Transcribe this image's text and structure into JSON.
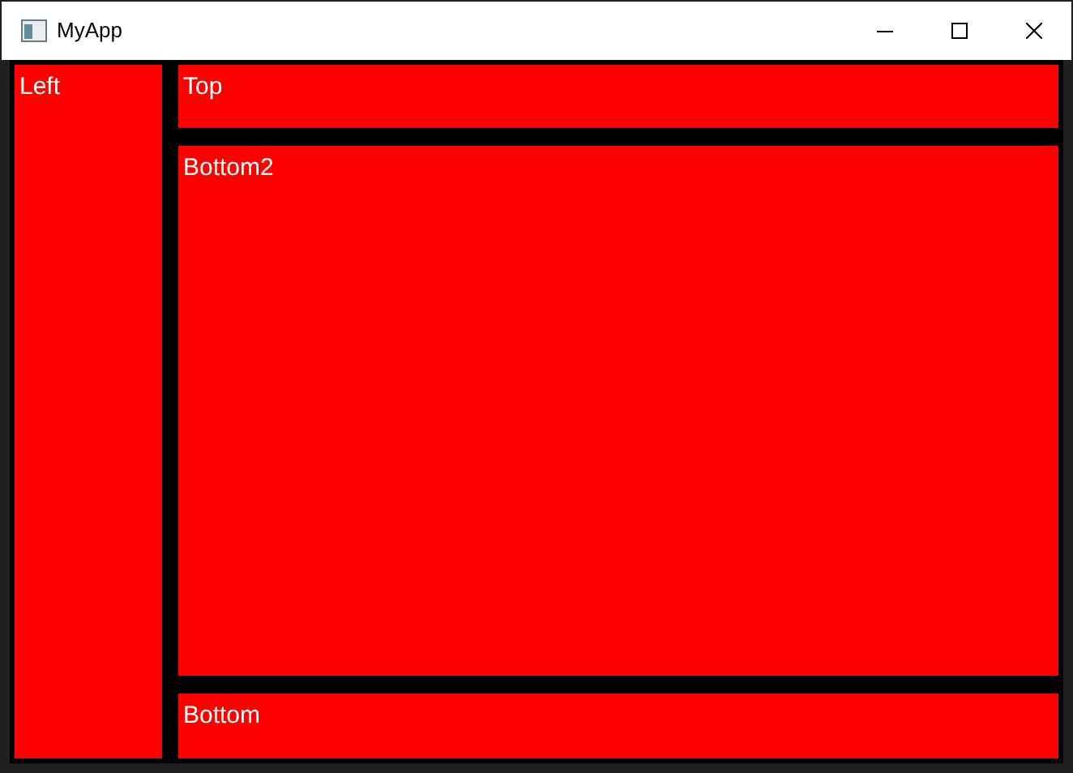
{
  "window": {
    "title": "MyApp"
  },
  "left_panel": {
    "label": "Left"
  },
  "right_panels": [
    {
      "label": "Top"
    },
    {
      "label": "Bottom2"
    },
    {
      "label": "Bottom"
    }
  ]
}
